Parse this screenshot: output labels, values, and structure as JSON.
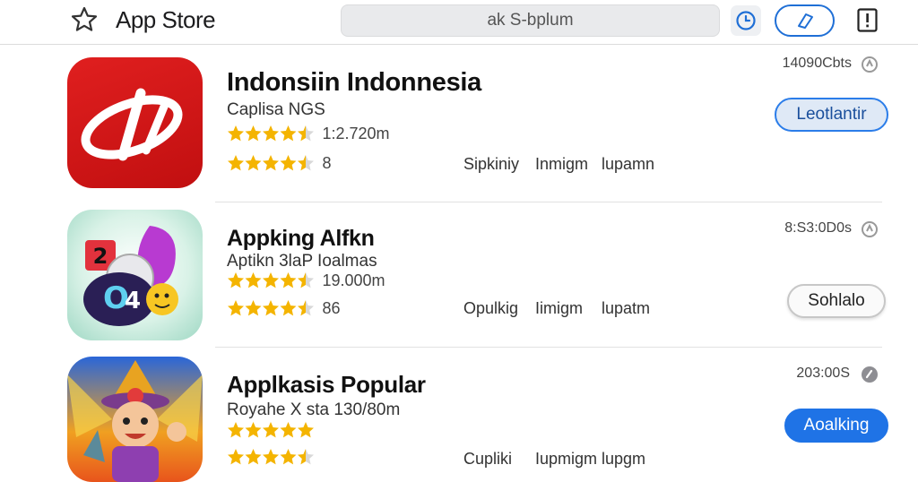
{
  "header": {
    "title": "App Store",
    "search_text": "ak S-bplum",
    "icons": [
      "star-icon",
      "clock-icon",
      "tag-icon",
      "info-icon"
    ]
  },
  "apps": [
    {
      "name": "Indonsiin Indonnesia",
      "subtitle": "Caplisa NGS",
      "rating_count": "1:2.720m",
      "rating": 4.5,
      "rating_short": "8",
      "stats": [
        "Sipkiniy",
        "Inmigm",
        "lupamn"
      ],
      "size": "14090Cbts",
      "button": "Leotlantir"
    },
    {
      "name": "Appking Alfkn",
      "subtitle": "Aptikn 3laP Ioalmas",
      "rating_count": "19.000m",
      "rating": 4.5,
      "rating_short": "86",
      "stats": [
        "Opulkig",
        "Iimigm",
        "lupatm"
      ],
      "size": "8:S3:0D0s",
      "button": "Sohlalo"
    },
    {
      "name": "Applkasis Popular",
      "subtitle": "Royahe X sta 130/80m",
      "rating_count": "",
      "rating": 5,
      "rating_short": "",
      "stats": [
        "Cupliki",
        "Iupmigm",
        "lupgm"
      ],
      "size": "203:00S",
      "button": "Aoalking"
    }
  ],
  "colors": {
    "accent": "#1f73e6",
    "star": "#f4b400",
    "divider": "#e2e2e2"
  }
}
